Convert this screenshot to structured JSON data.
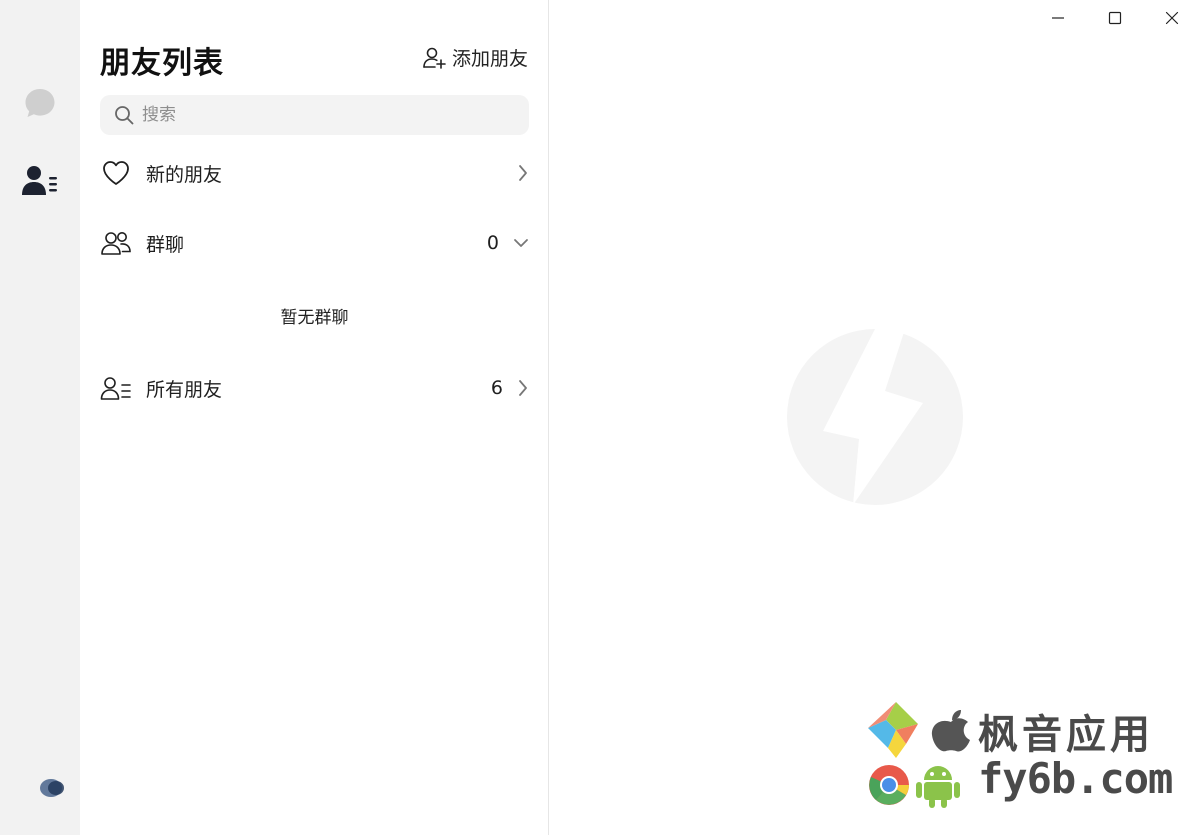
{
  "panel": {
    "title": "朋友列表",
    "add_friend_label": "添加朋友",
    "search_placeholder": "搜索"
  },
  "rows": {
    "new_friends": {
      "label": "新的朋友"
    },
    "group_chat": {
      "label": "群聊",
      "count": "0",
      "empty_text": "暂无群聊"
    },
    "all_friends": {
      "label": "所有朋友",
      "count": "6"
    }
  },
  "watermark": {
    "text_cn": "枫音应用",
    "text_url": "fy6b.com"
  },
  "icons": {
    "rail": [
      "chat-bubble-icon",
      "contacts-icon"
    ],
    "window": [
      "minimize-icon",
      "maximize-icon",
      "close-icon"
    ]
  },
  "colors": {
    "rail_bg": "#f2f2f2",
    "search_bg": "#f3f3f3",
    "text": "#1f1f1f",
    "divider": "#e6e6e6",
    "logo": "#f4f4f4"
  }
}
